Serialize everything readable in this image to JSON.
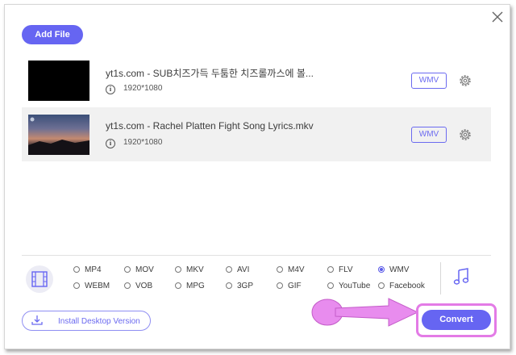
{
  "toolbar": {
    "add_file_label": "Add File"
  },
  "files": [
    {
      "name": "yt1s.com - SUB치즈가득 두툼한 치즈롤까스에 볼...",
      "resolution": "1920*1080",
      "format": "WMV",
      "thumbnail": "black-frame"
    },
    {
      "name": "yt1s.com - Rachel Platten Fight Song Lyrics.mkv",
      "resolution": "1920*1080",
      "format": "WMV",
      "thumbnail": "sunset-sky"
    }
  ],
  "formats": {
    "video_icon": "film-icon",
    "audio_icon": "music-note-icon",
    "selected": "WMV",
    "row1": [
      "MP4",
      "MOV",
      "MKV",
      "AVI",
      "M4V",
      "FLV",
      "WMV"
    ],
    "row2": [
      "WEBM",
      "VOB",
      "MPG",
      "3GP",
      "GIF",
      "YouTube",
      "Facebook"
    ]
  },
  "footer": {
    "install_label": "Install Desktop Version",
    "convert_label": "Convert"
  },
  "colors": {
    "accent": "#6665f2",
    "highlight": "#e37be6",
    "arrow": "#e88cee"
  }
}
